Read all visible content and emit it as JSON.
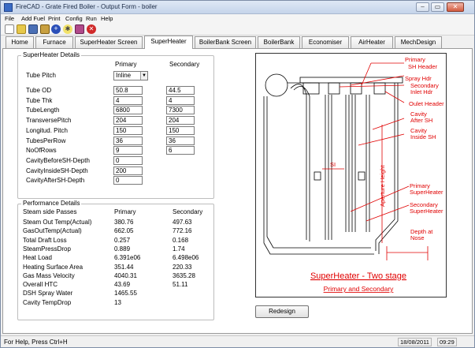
{
  "window": {
    "title": "FireCAD - Grate Fired Boiler - Output Form - boiler"
  },
  "menu": [
    "File",
    "Add Fuel",
    "Print",
    "Config",
    "Run",
    "Help"
  ],
  "toolbar": [
    "new-icon",
    "open-icon",
    "save-icon",
    "print-icon",
    "add-icon",
    "help-icon",
    "tools-icon",
    "stop-icon"
  ],
  "tabs": [
    "Home",
    "Furnace",
    "SuperHeater Screen",
    "SuperHeater",
    "BoilerBank Screen",
    "BoilerBank",
    "Economiser",
    "AirHeater",
    "MechDesign"
  ],
  "active_tab": "SuperHeater",
  "sh_details": {
    "legend": "SuperHeater Details",
    "col_primary": "Primary",
    "col_secondary": "Secondary",
    "tube_pitch_label": "Tube Pitch",
    "tube_pitch_value": "Inline",
    "rows": [
      {
        "label": "Tube OD",
        "primary": "50.8",
        "secondary": "44.5"
      },
      {
        "label": "Tube Thk",
        "primary": "4",
        "secondary": "4"
      },
      {
        "label": "TubeLength",
        "primary": "6800",
        "secondary": "7300"
      },
      {
        "label": "TransversePitch",
        "primary": "204",
        "secondary": "204"
      },
      {
        "label": "Longitud. Pitch",
        "primary": "150",
        "secondary": "150"
      },
      {
        "label": "TubesPerRow",
        "primary": "36",
        "secondary": "36"
      },
      {
        "label": "NoOfRows",
        "primary": "9",
        "secondary": "6"
      },
      {
        "label": "CavityBeforeSH-Depth",
        "primary": "0",
        "secondary": null
      },
      {
        "label": "CavityInsideSH-Depth",
        "primary": "200",
        "secondary": null
      },
      {
        "label": "CavityAfterSH-Depth",
        "primary": "0",
        "secondary": null
      }
    ]
  },
  "perf": {
    "legend": "Performance Details",
    "title": "Steam side Passes",
    "col_primary": "Primary",
    "col_secondary": "Secondary",
    "rows": [
      {
        "label": "Steam Out Temp(Actual)",
        "primary": "380.76",
        "secondary": "497.63"
      },
      {
        "label": "GasOutTemp(Actual)",
        "primary": "662.05",
        "secondary": "772.16"
      },
      {
        "label": "Total Draft Loss",
        "primary": "0.257",
        "secondary": "0.168"
      },
      {
        "label": "SteamPressDrop",
        "primary": "0.889",
        "secondary": "1.74"
      },
      {
        "label": "Heat Load",
        "primary": "6.391e06",
        "secondary": "6.498e06"
      },
      {
        "label": "Heating Surface Area",
        "primary": "351.44",
        "secondary": "220.33"
      },
      {
        "label": "Gas Mass Velocity",
        "primary": "4040.31",
        "secondary": "3635.28"
      },
      {
        "label": "Overall HTC",
        "primary": "43.69",
        "secondary": "51.11"
      },
      {
        "label": "DSH Spray Water",
        "primary": "1465.55",
        "secondary": null
      },
      {
        "label": "Cavity TempDrop",
        "primary": "13",
        "secondary": null
      }
    ]
  },
  "diagram": {
    "labels": [
      "Primary",
      "SH Header",
      "Spray Hdr",
      "Secondary",
      "Inlet Hdr",
      "Oulet Header",
      "Cavity",
      "After SH",
      "Cavity",
      "Inside SH",
      "SI",
      "Aperture Height",
      "Primary",
      "SuperHeater",
      "Secondary",
      "SuperHeater",
      "Depth at",
      "Nose"
    ],
    "title": "SuperHeater - Two stage",
    "subtitle": "Primary and Secondary"
  },
  "redesign_label": "Redesign",
  "status": {
    "message": "For Help, Press Ctrl+H",
    "date": "18/08/2011",
    "time": "09:29"
  },
  "colors": {
    "accent": "#e00000"
  }
}
